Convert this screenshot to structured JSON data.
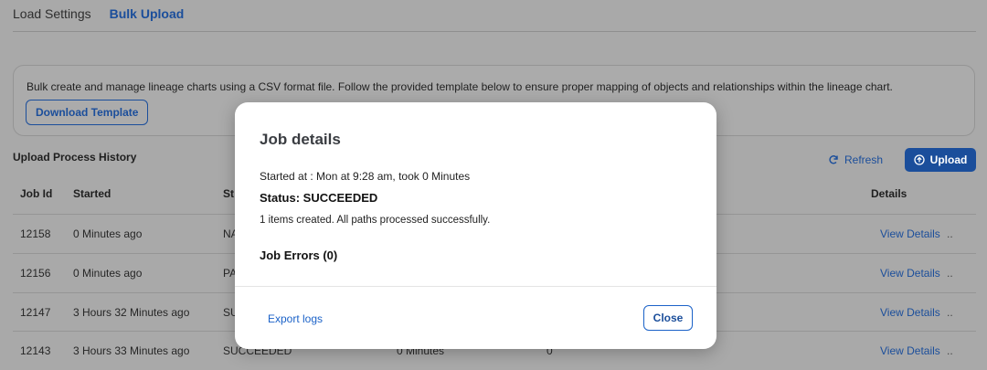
{
  "tabs": [
    {
      "label": "Load Settings"
    },
    {
      "label": "Bulk Upload"
    }
  ],
  "info": {
    "text": "Bulk create and manage lineage charts using a CSV format file. Follow the provided template below to ensure proper mapping of objects and relationships within the lineage chart.",
    "download_label": "Download Template"
  },
  "history": {
    "title": "Upload Process History",
    "refresh_label": "Refresh",
    "upload_label": "Upload"
  },
  "table": {
    "headers": {
      "job_id": "Job Id",
      "started": "Started",
      "status": "St",
      "details": "Details"
    },
    "rows": [
      {
        "job_id": "12158",
        "started": "0 Minutes ago",
        "status": "NA",
        "details": "View Details",
        "more": ".."
      },
      {
        "job_id": "12156",
        "started": "0 Minutes ago",
        "status": "PA",
        "details": "View Details",
        "more": ".."
      },
      {
        "job_id": "12147",
        "started": "3 Hours 32 Minutes ago",
        "status": "SU",
        "details": "View Details",
        "more": ".."
      },
      {
        "job_id": "12143",
        "started": "3 Hours 33 Minutes ago",
        "status": "SUCCEEDED",
        "duration": "0 Minutes",
        "count": "0",
        "details": "View Details",
        "more": ".."
      }
    ]
  },
  "modal": {
    "title": "Job details",
    "started": "Started at : Mon at 9:28 am, took 0 Minutes",
    "status": "Status: SUCCEEDED",
    "summary": "1 items created. All paths processed successfully.",
    "errors": "Job Errors (0)",
    "export_label": "Export logs",
    "close_label": "Close"
  },
  "colors": {
    "accent": "#1b4e9b",
    "overlay": "#a9a9a9"
  },
  "icons": {
    "refresh": "refresh-icon",
    "upload": "upload-icon"
  }
}
